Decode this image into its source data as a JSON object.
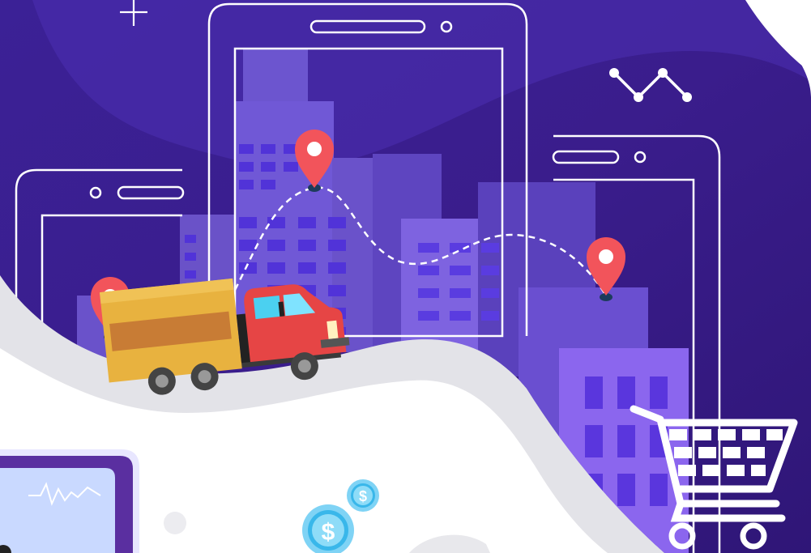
{
  "scene": {
    "title": "",
    "colors": {
      "sky_dark": "#3a1f8f",
      "sky_mid": "#4a2aa8",
      "sky_light": "#5a3fc0",
      "building_purple": "#7a5ad6",
      "building_window": "#8f6cf0",
      "window_bright": "#5b3fe6",
      "pin_red": "#f2545b",
      "route_dash": "#ffffff",
      "wave_gray": "#e3e3e8",
      "truck_box": "#e8b23f",
      "truck_box_stripe": "#c87c35",
      "truck_cab": "#e64545",
      "coin_blue": "#7fd3f5",
      "coin_dark": "#39b7ea",
      "panel_border": "#5a2fa0",
      "panel_fill": "#c9d9ff"
    },
    "icons": [
      "plus-sparkle-icon",
      "trend-line-icon",
      "location-pin-icon",
      "shopping-cart-icon",
      "dollar-coin-icon",
      "delivery-truck-icon",
      "smartphone-icon"
    ],
    "coins": [
      {
        "symbol": "$"
      },
      {
        "symbol": "$"
      }
    ]
  }
}
